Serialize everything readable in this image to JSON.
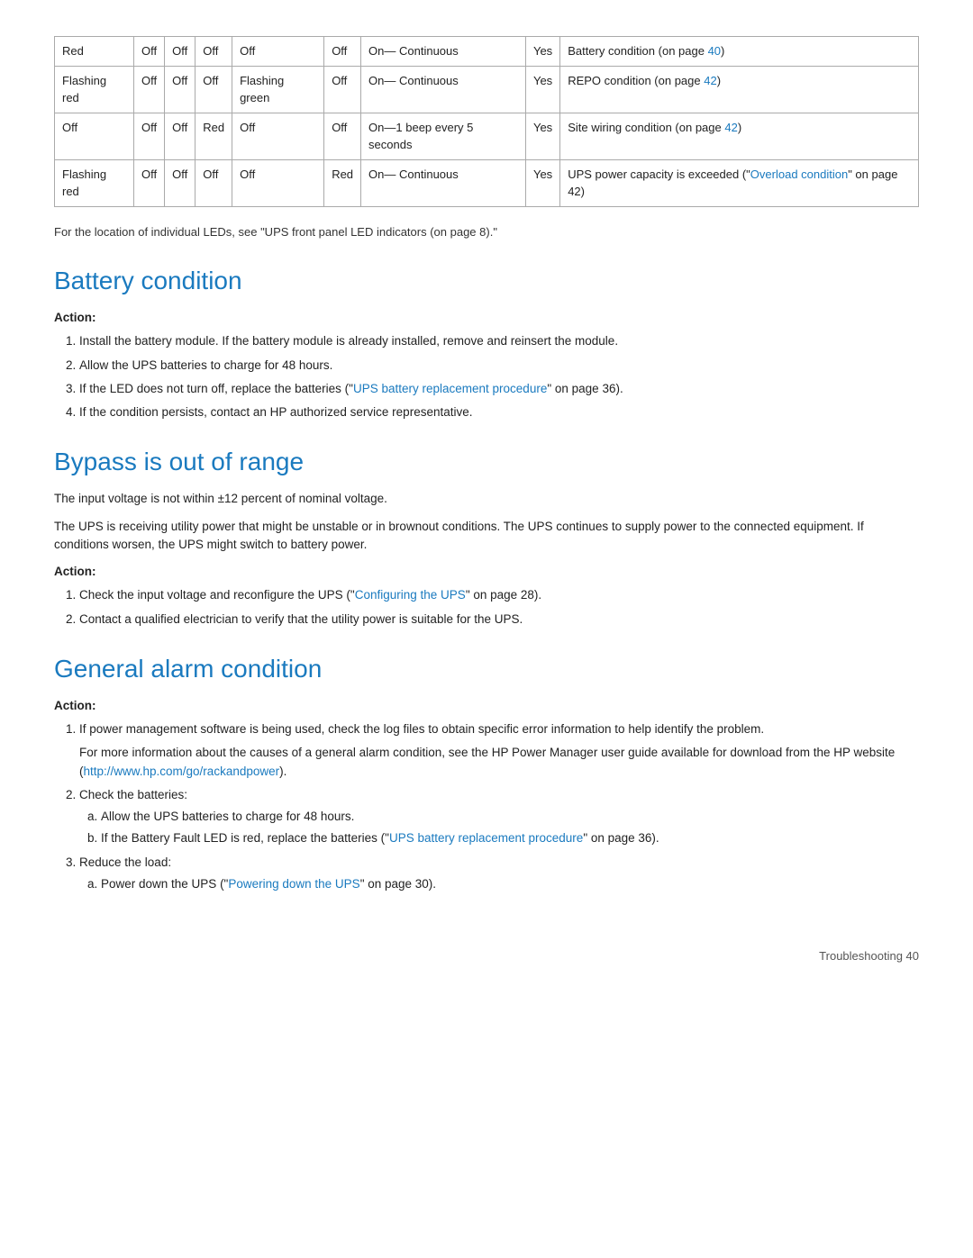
{
  "table": {
    "rows": [
      {
        "col1": "Red",
        "col2": "Off",
        "col3": "Off",
        "col4": "Off",
        "col5": "Off",
        "col6": "Off",
        "col7": "On—\nContinuous",
        "col8": "Yes",
        "col9": "Battery condition (on page 40)"
      },
      {
        "col1": "Flashing red",
        "col2": "Off",
        "col3": "Off",
        "col4": "Off",
        "col5": "Flashing green",
        "col6": "Off",
        "col7": "On—\nContinuous",
        "col8": "Yes",
        "col9": "REPO condition (on page 42)"
      },
      {
        "col1": "Off",
        "col2": "Off",
        "col3": "Off",
        "col4": "Red",
        "col5": "Off",
        "col6": "Off",
        "col7": "On—1 beep every 5 seconds",
        "col8": "Yes",
        "col9": "Site wiring condition (on page 42)"
      },
      {
        "col1": "Flashing red",
        "col2": "Off",
        "col3": "Off",
        "col4": "Off",
        "col5": "Off",
        "col6": "Red",
        "col7": "On—\nContinuous",
        "col8": "Yes",
        "col9": "UPS power capacity is exceeded (\"Overload condition\" on page 42)"
      }
    ]
  },
  "note": "For the location of individual LEDs, see \"UPS front panel LED indicators (on page 8).\"",
  "battery_condition": {
    "heading": "Battery condition",
    "action_label": "Action",
    "items": [
      "Install the battery module. If the battery module is already installed, remove and reinsert the module.",
      "Allow the UPS batteries to charge for 48 hours.",
      "If the LED does not turn off, replace the batteries (\"UPS battery replacement procedure\" on page 36).",
      "If the condition persists, contact an HP authorized service representative."
    ],
    "link_text_item3": "UPS battery replacement procedure",
    "link_page_item3": "36"
  },
  "bypass_out_of_range": {
    "heading": "Bypass is out of range",
    "para1": "The input voltage is not within ±12 percent of nominal voltage.",
    "para2": "The UPS is receiving utility power that might be unstable or in brownout conditions. The UPS continues to supply power to the connected equipment. If conditions worsen, the UPS might switch to battery power.",
    "action_label": "Action",
    "items": [
      {
        "text_before": "Check the input voltage and reconfigure the UPS (",
        "link_text": "Configuring the UPS",
        "text_after": " on page 28)."
      },
      {
        "text": "Contact a qualified electrician to verify that the utility power is suitable for the UPS."
      }
    ]
  },
  "general_alarm": {
    "heading": "General alarm condition",
    "action_label": "Action",
    "item1_text": "If power management software is being used, check the log files to obtain specific error information to help identify the problem.",
    "item1_sub": "For more information about the causes of a general alarm condition, see the HP Power Manager user guide available for download from the HP website (http://www.hp.com/go/rackandpower).",
    "item1_link": "http://www.hp.com/go/rackandpower",
    "item2_text": "Check the batteries:",
    "item2a": "Allow the UPS batteries to charge for 48 hours.",
    "item2b_before": "If the Battery Fault LED is red, replace the batteries (\"",
    "item2b_link": "UPS battery replacement procedure",
    "item2b_after": "\" on page 36).",
    "item3_text": "Reduce the load:",
    "item3a_before": "Power down the UPS (\"",
    "item3a_link": "Powering down the UPS",
    "item3a_after": "\" on page 30)."
  },
  "footer": {
    "text": "Troubleshooting   40"
  }
}
